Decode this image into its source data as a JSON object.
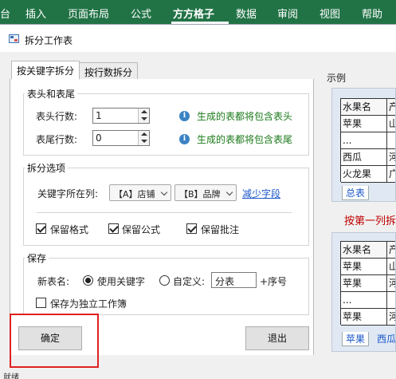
{
  "ribbon": {
    "tabs": [
      "台",
      "插入",
      "页面布局",
      "公式",
      "方方格子",
      "数据",
      "审阅",
      "视图",
      "帮助"
    ],
    "active": "方方格子"
  },
  "dialog": {
    "title": "拆分工作表",
    "tabs": [
      "按关键字拆分",
      "按行数拆分"
    ],
    "active_tab": "按关键字拆分",
    "header_footer": {
      "group_title": "表头和表尾",
      "header_label": "表头行数:",
      "header_value": "1",
      "footer_label": "表尾行数:",
      "footer_value": "0",
      "header_hint": "生成的表都将包含表头",
      "footer_hint": "生成的表都将包含表尾"
    },
    "split_options": {
      "group_title": "拆分选项",
      "key_column_label": "关键字所在列:",
      "combo1": "【A】店铺",
      "combo2": "【B】品牌",
      "reduce_link": "减少字段",
      "keep_format": "保留格式",
      "keep_formula": "保留公式",
      "keep_comment": "保留批注"
    },
    "save": {
      "group_title": "保存",
      "new_name_label": "新表名:",
      "use_keyword": "使用关键字",
      "custom": "自定义:",
      "custom_value": "分表",
      "seq_suffix": "+序号",
      "independent_workbook": "保存为独立工作簿"
    },
    "ok_button": "确定",
    "exit_button": "退出"
  },
  "example": {
    "label": "示例",
    "top_table": {
      "headers": [
        "水果名",
        "产"
      ],
      "rows": [
        [
          "苹果",
          "山"
        ],
        [
          "...",
          ""
        ],
        [
          "西瓜",
          "河"
        ],
        [
          "火龙果",
          "广"
        ]
      ],
      "sheet_tab": "总表"
    },
    "caption": "按第一列拆",
    "bottom_table": {
      "headers": [
        "水果名",
        "产"
      ],
      "rows": [
        [
          "苹果",
          "山"
        ],
        [
          "苹果",
          "河"
        ],
        [
          "...",
          ""
        ],
        [
          "苹果",
          "河"
        ]
      ],
      "sheet_tabs": [
        "苹果",
        "西瓜"
      ]
    }
  },
  "status": {
    "left_text": "就绪"
  }
}
